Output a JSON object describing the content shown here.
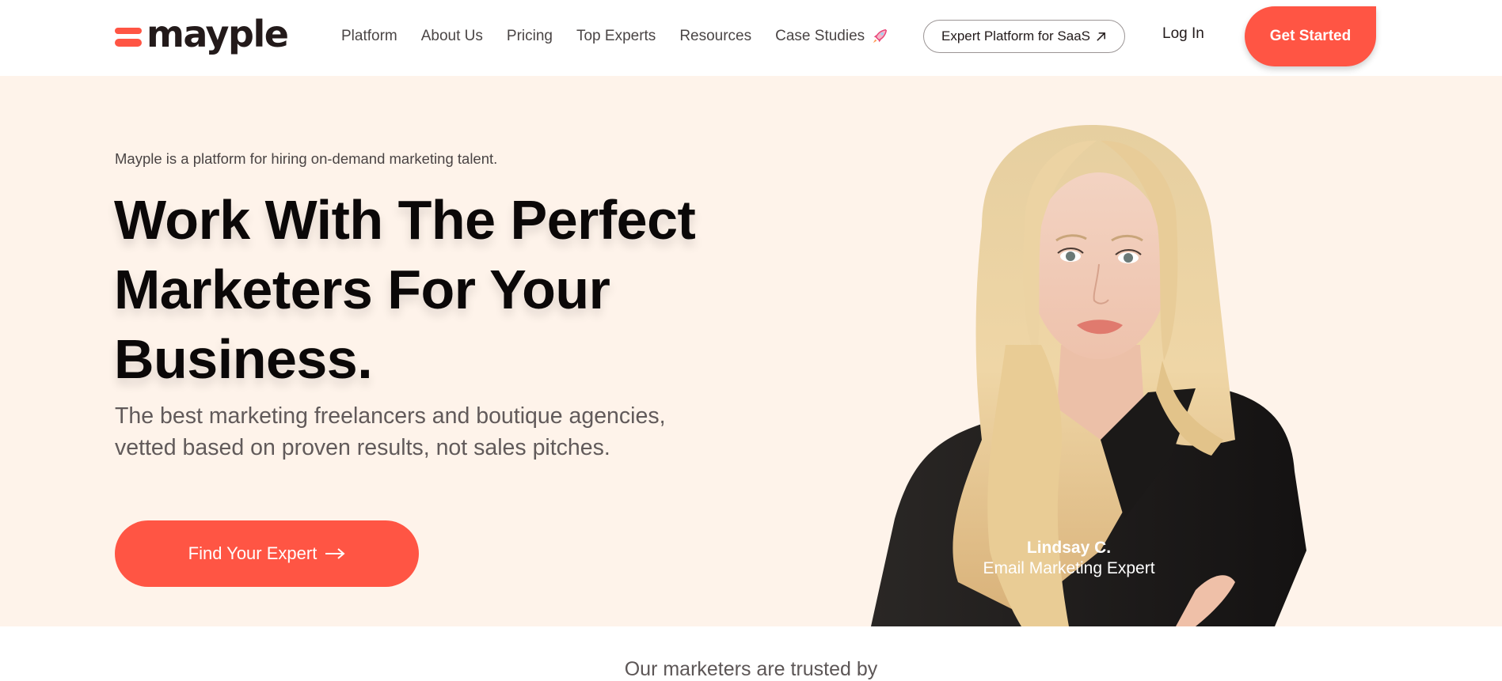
{
  "brand": {
    "name": "mayple",
    "accent_color": "#ff5544",
    "hero_background": "#fef3ea"
  },
  "nav": {
    "items": [
      {
        "label": "Platform"
      },
      {
        "label": "About Us"
      },
      {
        "label": "Pricing"
      },
      {
        "label": "Top Experts"
      },
      {
        "label": "Resources"
      },
      {
        "label": "Case Studies",
        "icon": "rocket-icon"
      }
    ],
    "saas_button": {
      "label": "Expert Platform for SaaS",
      "icon": "arrow-up-right-icon"
    },
    "login_label": "Log In",
    "cta_label": "Get Started"
  },
  "hero": {
    "eyebrow": "Mayple is a platform for hiring on-demand marketing talent.",
    "headline_lines": [
      "Work With The Perfect",
      "Marketers For Your",
      "Business."
    ],
    "subhead_lines": [
      "The best marketing freelancers and boutique agencies,",
      "vetted based on proven results, not sales pitches."
    ],
    "cta": {
      "label": "Find Your Expert",
      "icon": "arrow-right-icon"
    },
    "expert": {
      "name": "Lindsay C.",
      "role": "Email Marketing Expert"
    }
  },
  "trusted": {
    "label": "Our marketers are trusted by"
  }
}
